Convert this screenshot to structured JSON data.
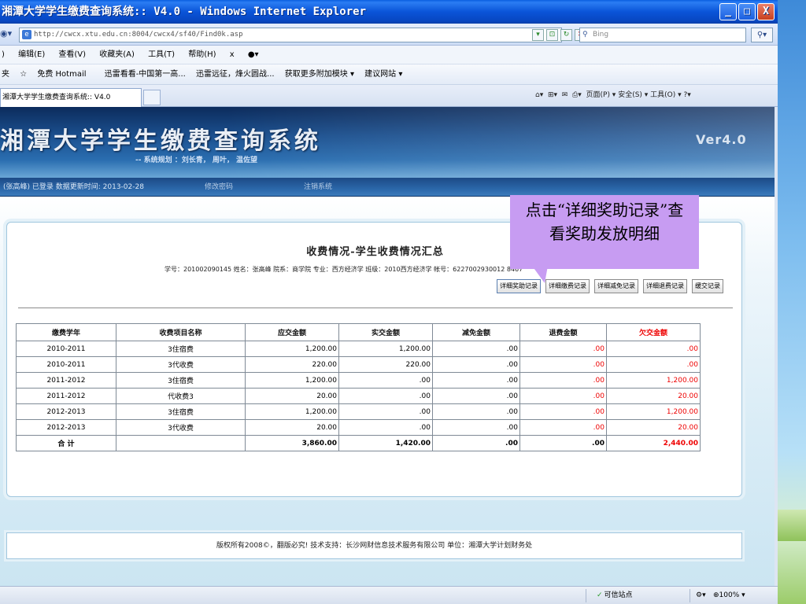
{
  "window": {
    "title": "湘潭大学学生缴费查询系统:: V4.0 - Windows Internet Explorer",
    "buttons": {
      "minimize": "_",
      "maximize": "□",
      "close": "X"
    }
  },
  "address": {
    "url_host": "http://cwcx.xtu.edu.cn",
    "url_path": ":8004/cwcx4/sf40/Find0k.asp",
    "search_placeholder": "Bing"
  },
  "menu": [
    "编辑(E)",
    "查看(V)",
    "收藏夹(A)",
    "工具(T)",
    "帮助(H)",
    "x"
  ],
  "menu_prefix": ")",
  "favorites": [
    "夹",
    "免费 Hotmail",
    "迅雷看看-中国第一高...",
    "迅雷远征，烽火圆战...",
    "获取更多附加模块 ▾",
    "建议网站 ▾"
  ],
  "tab": {
    "label": "湘潭大学学生缴费查询系统:: V4.0"
  },
  "commandbar": "页面(P) ▾  安全(S) ▾  工具(O) ▾",
  "banner": {
    "title": "湘潭大学学生缴费查询系统",
    "subtitle": "-- 系统规划 ：刘长青， 周叶， 温佐望",
    "version": "Ver4.0"
  },
  "nav": {
    "login": "(张高峰) 已登录  数据更新时间: 2013-02-28",
    "change_password": "修改密码",
    "logout": "注销系统"
  },
  "report": {
    "title": "收费情况-学生收费情况汇总",
    "info": "学号：201002090145  姓名：张高峰  院系：商学院  专业：西方经济学  班级：2010西方经济学  帐号：6227002930012 8467",
    "buttons": [
      "详细奖助记录",
      "详细缴费记录",
      "详细减免记录",
      "详细退费记录",
      "缓交记录"
    ]
  },
  "table": {
    "headers": [
      "缴费学年",
      "收费项目名称",
      "应交金额",
      "实交金额",
      "减免金额",
      "退费金额",
      "欠交金额"
    ],
    "rows": [
      [
        "2010-2011",
        "3住宿费",
        "1,200.00",
        "1,200.00",
        ".00",
        ".00",
        ".00"
      ],
      [
        "2010-2011",
        "3代收费",
        "220.00",
        "220.00",
        ".00",
        ".00",
        ".00"
      ],
      [
        "2011-2012",
        "3住宿费",
        "1,200.00",
        ".00",
        ".00",
        ".00",
        "1,200.00"
      ],
      [
        "2011-2012",
        "代收费3",
        "20.00",
        ".00",
        ".00",
        ".00",
        "20.00"
      ],
      [
        "2012-2013",
        "3住宿费",
        "1,200.00",
        ".00",
        ".00",
        ".00",
        "1,200.00"
      ],
      [
        "2012-2013",
        "3代收费",
        "20.00",
        ".00",
        ".00",
        ".00",
        "20.00"
      ]
    ],
    "total": [
      "合  计",
      "",
      "3,860.00",
      "1,420.00",
      ".00",
      ".00",
      "2,440.00"
    ]
  },
  "footer": "版权所有2008©，翻版必究! 技术支持：长沙网财信息技术服务有限公司   单位：湘潭大学计划财务处",
  "callout": "点击“详细奖助记录”查看奖助发放明细",
  "status": {
    "trusted": "可信站点",
    "zoom": "100%"
  },
  "colors": {
    "titlebar": "#0a54d8",
    "banner": "#1b4f8e",
    "callout": "#c79cf2",
    "owed": "#e00000"
  }
}
